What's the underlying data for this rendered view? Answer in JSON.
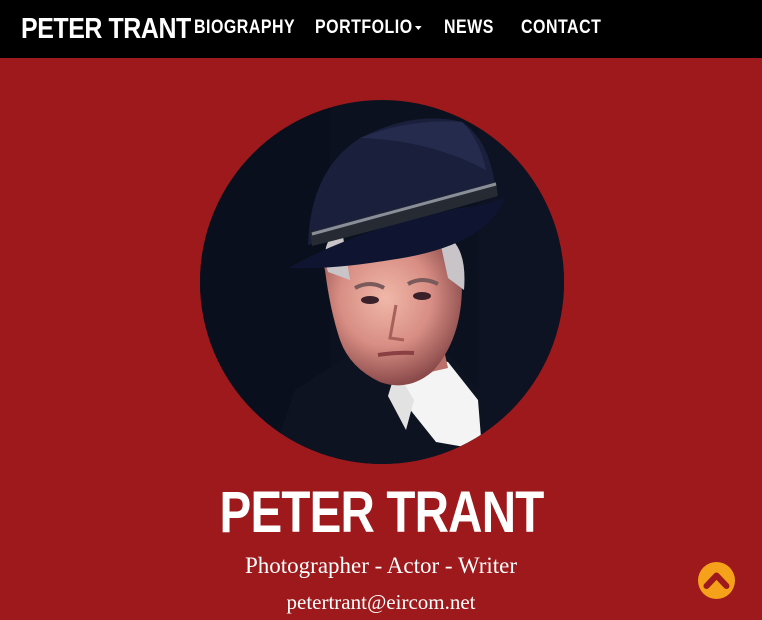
{
  "navbar": {
    "brand": "PETER TRANT",
    "items": [
      {
        "label": "BIOGRAPHY"
      },
      {
        "label": "PORTFOLIO"
      },
      {
        "label": "NEWS"
      },
      {
        "label": "CONTACT"
      }
    ]
  },
  "hero": {
    "name": "PETER TRANT",
    "tagline": "Photographer - Actor - Writer",
    "email": "petertrant@eircom.net"
  },
  "icons": {
    "portfolio_dropdown": "caret-down-icon",
    "back_to_top": "chevron-up-icon"
  },
  "colors": {
    "background": "#9d191b",
    "navbar": "#000000",
    "text": "#ffffff",
    "accent": "#f6a11a"
  }
}
